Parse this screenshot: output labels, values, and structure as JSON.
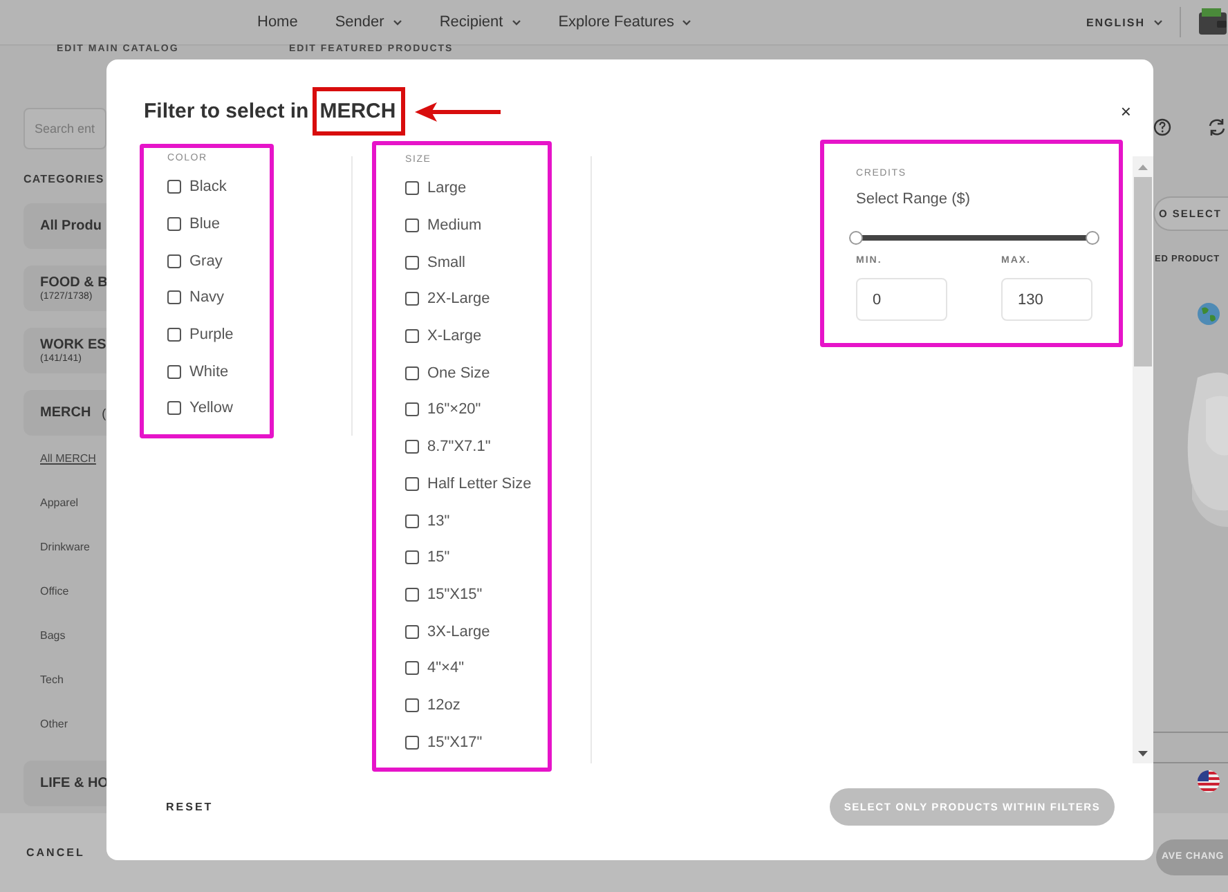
{
  "nav": {
    "items": [
      {
        "label": "Home",
        "menu": false
      },
      {
        "label": "Sender",
        "menu": true
      },
      {
        "label": "Recipient",
        "menu": true
      },
      {
        "label": "Explore Features",
        "menu": true
      }
    ],
    "language": "ENGLISH"
  },
  "catalog_tabs": [
    "EDIT MAIN CATALOG",
    "EDIT FEATURED PRODUCTS"
  ],
  "search": {
    "placeholder": "Search ent"
  },
  "sidebar": {
    "heading": "CATEGORIES",
    "categories": [
      {
        "name": "All Produ"
      },
      {
        "name": "FOOD & B",
        "count": "(1727/1738)"
      },
      {
        "name": "WORK ES",
        "count": "(141/141)"
      },
      {
        "name": "MERCH",
        "count": "(",
        "children": [
          {
            "label": "All MERCH",
            "selected": true
          },
          {
            "label": "Apparel",
            "selected": false
          },
          {
            "label": "Drinkware",
            "selected": false
          },
          {
            "label": "Office",
            "selected": false
          },
          {
            "label": "Bags",
            "selected": false
          },
          {
            "label": "Tech",
            "selected": false
          },
          {
            "label": "Other",
            "selected": false
          }
        ]
      },
      {
        "name": "LIFE & HO"
      }
    ]
  },
  "right_rail": {
    "select_button": "O SELECT",
    "featured_label": "ED PRODUCT"
  },
  "bottom_bar": {
    "cancel": "CANCEL",
    "save": "AVE CHANG"
  },
  "modal": {
    "title": "Filter to select in",
    "title_highlight": "MERCH",
    "close": "×",
    "color": {
      "heading": "COLOR",
      "options": [
        {
          "label": "Black",
          "checked": false
        },
        {
          "label": "Blue",
          "checked": false
        },
        {
          "label": "Gray",
          "checked": false
        },
        {
          "label": "Navy",
          "checked": false
        },
        {
          "label": "Purple",
          "checked": false
        },
        {
          "label": "White",
          "checked": false
        },
        {
          "label": "Yellow",
          "checked": false
        }
      ]
    },
    "size": {
      "heading": "SIZE",
      "options": [
        {
          "label": "Large",
          "checked": false
        },
        {
          "label": "Medium",
          "checked": false
        },
        {
          "label": "Small",
          "checked": false
        },
        {
          "label": "2X-Large",
          "checked": false
        },
        {
          "label": "X-Large",
          "checked": false
        },
        {
          "label": "One Size",
          "checked": false
        },
        {
          "label": "16\"×20\"",
          "checked": false
        },
        {
          "label": "8.7\"X7.1\"",
          "checked": false
        },
        {
          "label": "Half Letter Size",
          "checked": false
        },
        {
          "label": "13\"",
          "checked": false
        },
        {
          "label": "15\"",
          "checked": false
        },
        {
          "label": "15\"X15\"",
          "checked": false
        },
        {
          "label": "3X-Large",
          "checked": false
        },
        {
          "label": "4\"×4\"",
          "checked": false
        },
        {
          "label": "12oz",
          "checked": false
        },
        {
          "label": "15\"X17\"",
          "checked": false
        }
      ]
    },
    "credits": {
      "heading": "CREDITS",
      "label": "Select Range ($)",
      "thumbs": [
        {
          "level": 0
        },
        {
          "level": 1
        }
      ],
      "min_label": "MIN.",
      "min_value": "0",
      "max_label": "MAX.",
      "max_value": "130"
    },
    "reset": "RESET",
    "apply": {
      "label": "SELECT ONLY PRODUCTS WITHIN FILTERS",
      "disabled": true
    }
  }
}
